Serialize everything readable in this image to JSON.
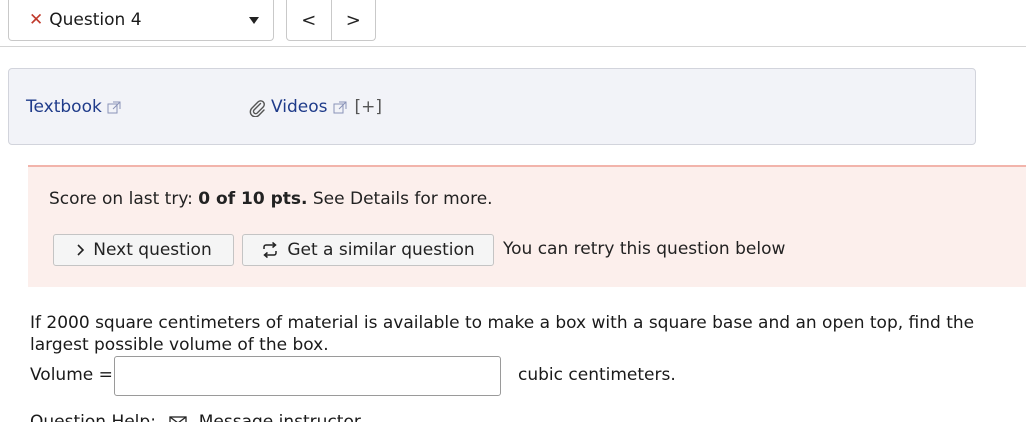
{
  "nav": {
    "question_label": "Question 4",
    "prev_label": "<",
    "next_label": ">"
  },
  "resources": {
    "textbook_label": "Textbook",
    "videos_label": "Videos",
    "plus_label": "[+]"
  },
  "score": {
    "prefix": "Score on last try: ",
    "value": "0 of 10 pts.",
    "suffix": " See Details for more.",
    "next_button": "Next question",
    "similar_button": "Get a similar question",
    "retry_text": "You can retry this question below"
  },
  "question": {
    "text": "If 2000 square centimeters of material is available to make a box with a square base and an open top, find the largest possible volume of the box.",
    "volume_label": "Volume =",
    "volume_value": "",
    "units": "cubic centimeters."
  },
  "footer": {
    "help_label": "Question Help:",
    "message_label": "Message instructor"
  },
  "colors": {
    "link": "#1f3b8a",
    "error_x": "#c0392b",
    "score_bg": "#fcefec",
    "resources_bg": "#f2f3f8"
  }
}
